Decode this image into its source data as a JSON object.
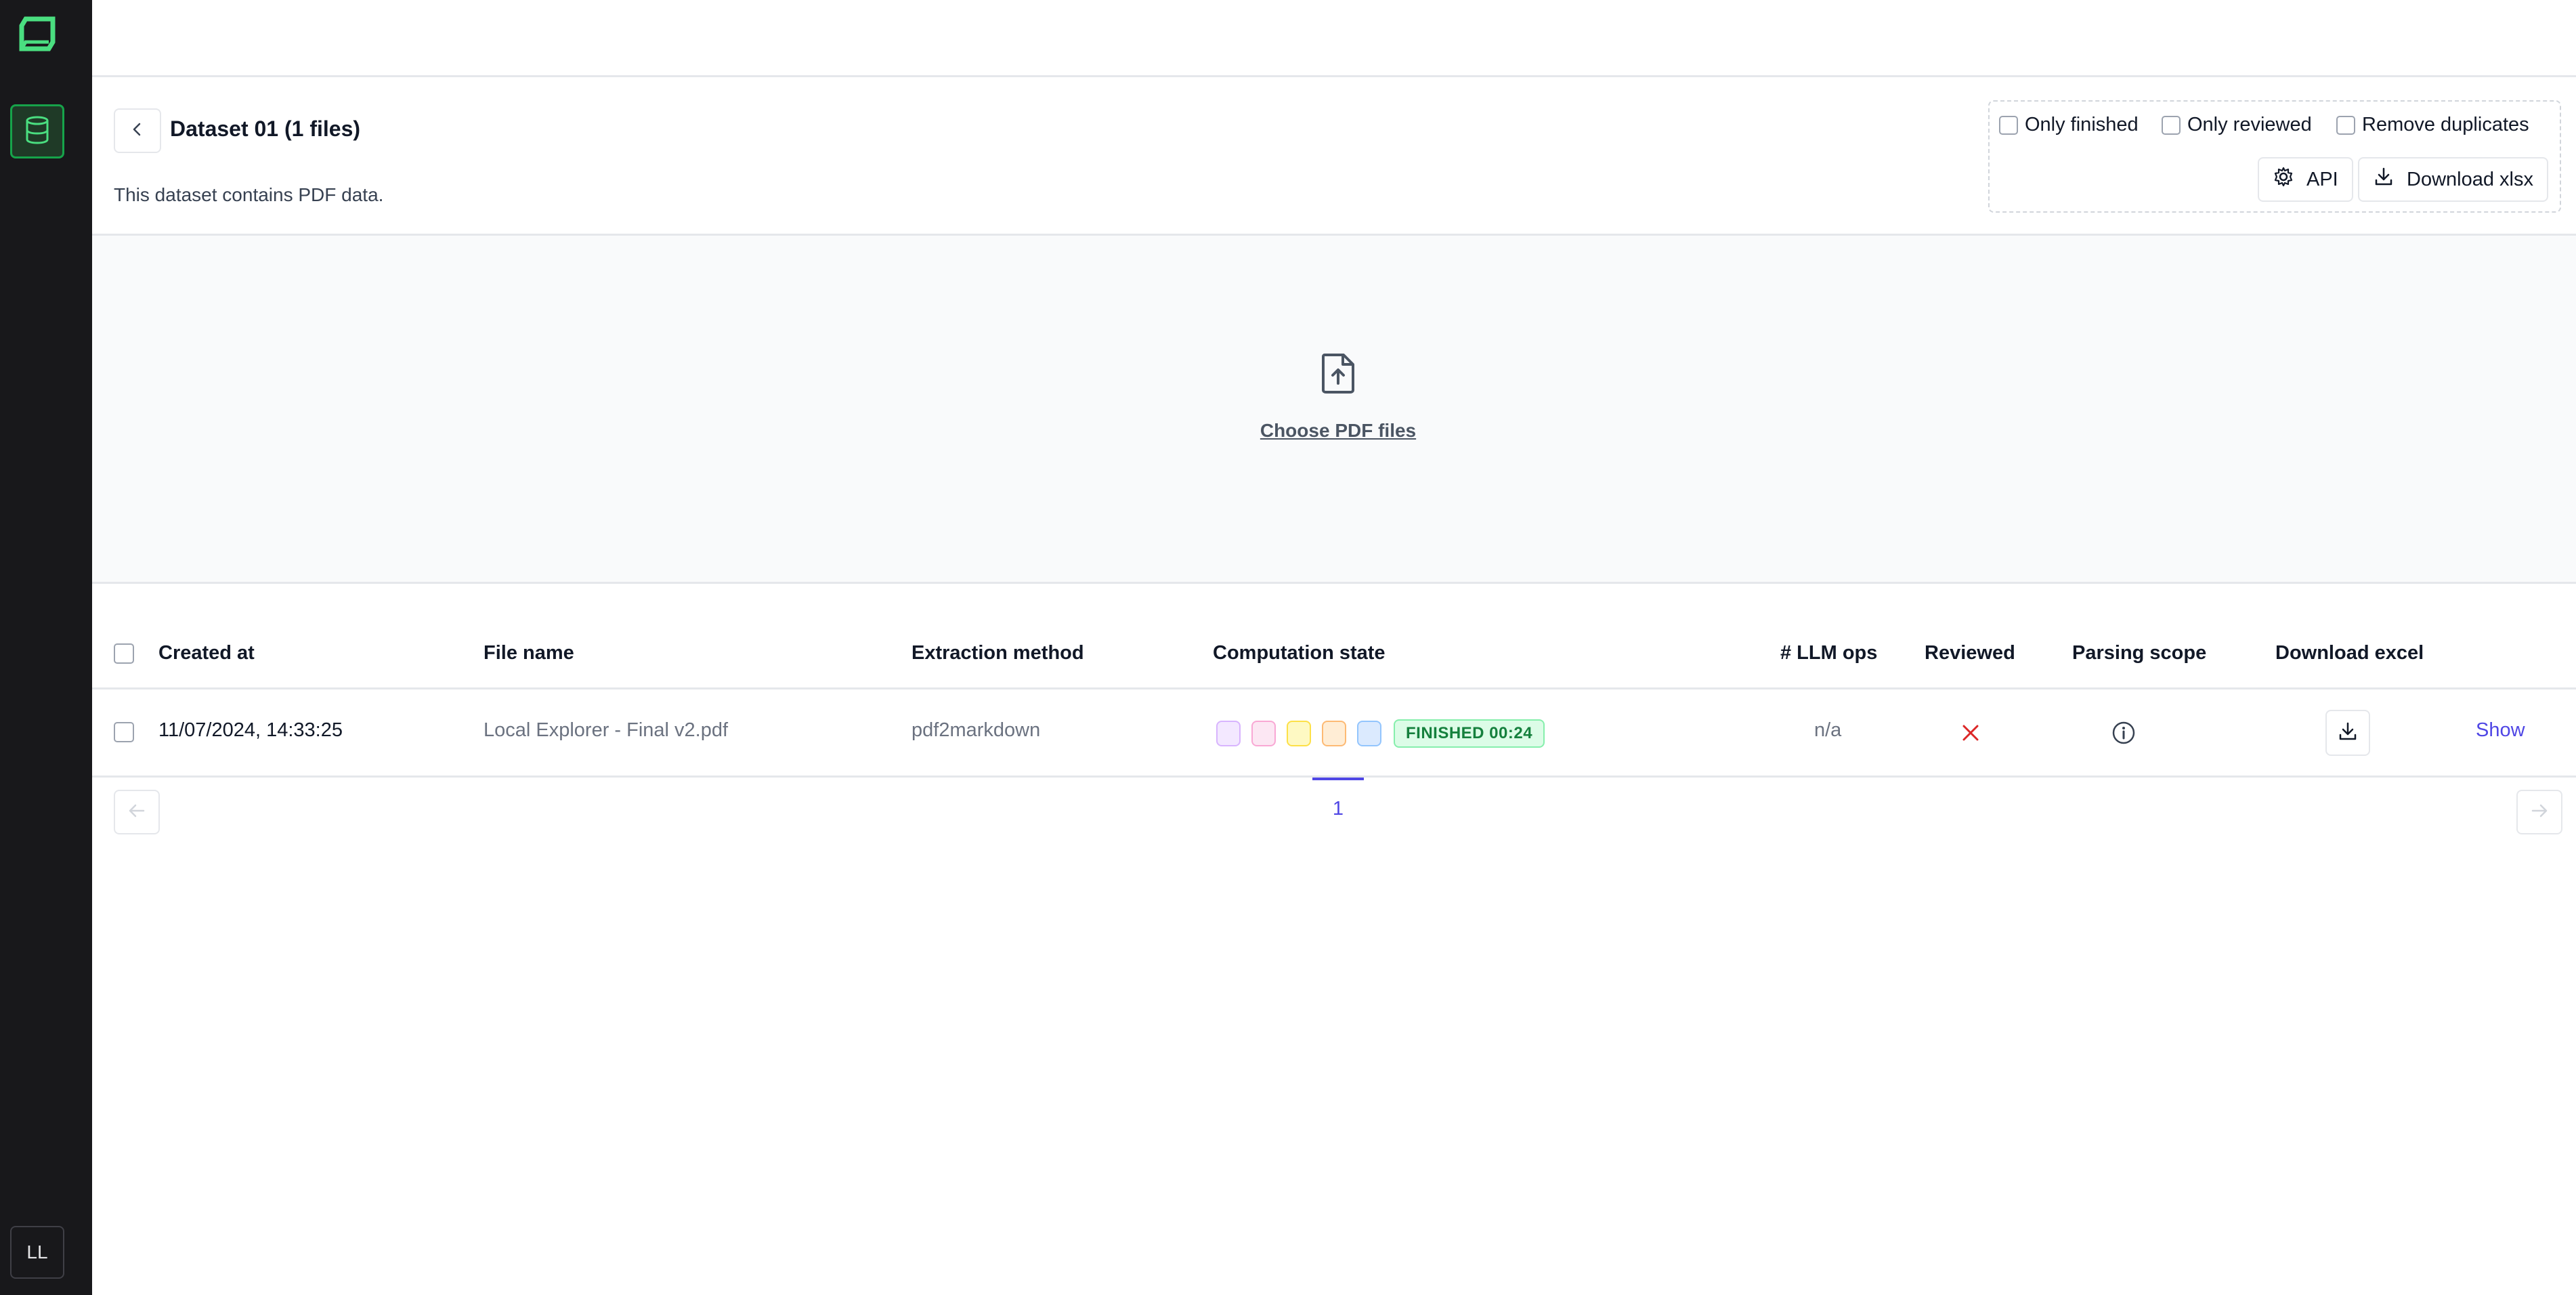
{
  "sidebar": {
    "nav_icon": "database-icon",
    "avatar_initials": "LL"
  },
  "header": {
    "title": "Dataset 01 (1 files)",
    "description": "This dataset contains PDF data."
  },
  "filters": {
    "only_finished": "Only finished",
    "only_reviewed": "Only reviewed",
    "remove_duplicates": "Remove duplicates",
    "api_label": "API",
    "download_xlsx_label": "Download xlsx"
  },
  "upload": {
    "icon": "file-upload-icon",
    "link_label": "Choose PDF files"
  },
  "table": {
    "columns": {
      "created_at": "Created at",
      "file_name": "File name",
      "extraction_method": "Extraction method",
      "computation_state": "Computation state",
      "llm_ops": "# LLM ops",
      "reviewed": "Reviewed",
      "parsing_scope": "Parsing scope",
      "download_excel": "Download excel"
    },
    "rows": [
      {
        "created_at": "11/07/2024, 14:33:25",
        "file_name": "Local Explorer - Final v2.pdf",
        "extraction_method": "pdf2markdown",
        "state_chips": [
          {
            "bg": "#f3e8ff",
            "border": "#d8b4fe"
          },
          {
            "bg": "#fce7f3",
            "border": "#f9a8d4"
          },
          {
            "bg": "#fef9c3",
            "border": "#fde047"
          },
          {
            "bg": "#ffedd5",
            "border": "#fdba74"
          },
          {
            "bg": "#dbeafe",
            "border": "#93c5fd"
          }
        ],
        "status": "FINISHED 00:24",
        "llm_ops": "n/a",
        "reviewed_icon": "x-icon",
        "parsing_scope_icon": "info-icon",
        "show_label": "Show"
      }
    ]
  },
  "pagination": {
    "current_page": "1"
  },
  "colors": {
    "accent": "#4f46e5",
    "brand_green": "#22c55e",
    "sidebar_bg": "#18181b",
    "reviewed_x": "#dc2626"
  }
}
